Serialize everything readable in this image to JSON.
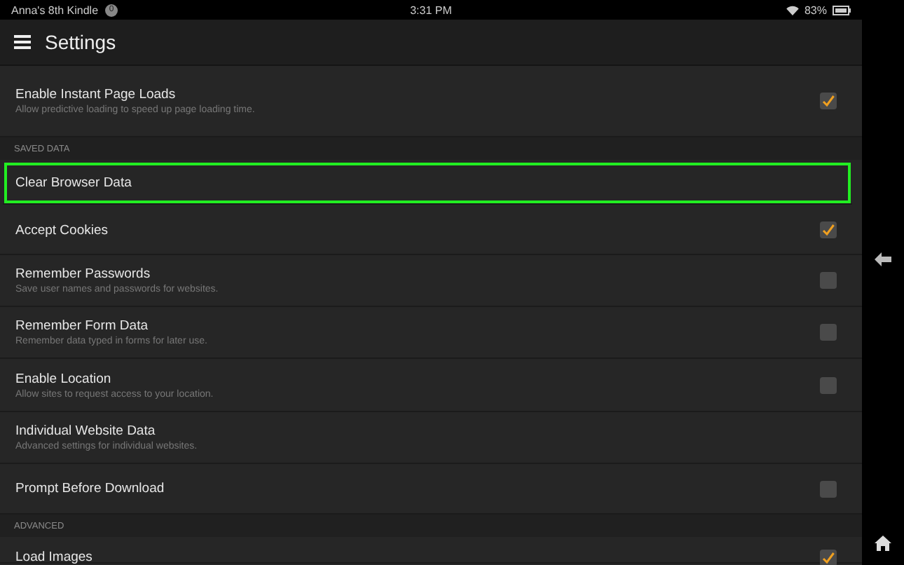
{
  "status_bar": {
    "device_name": "Anna's 8th Kindle",
    "notification_count": "0",
    "time": "3:31 PM",
    "battery": "83%"
  },
  "toolbar": {
    "title": "Settings"
  },
  "items": [
    {
      "kind": "toggle",
      "label": "Enable Instant Page Loads",
      "description": "Allow predictive loading to speed up page loading time.",
      "checked": true,
      "highlighted": false
    },
    {
      "kind": "header",
      "label": "SAVED DATA"
    },
    {
      "kind": "link",
      "label": "Clear Browser Data",
      "highlighted": true
    },
    {
      "kind": "toggle",
      "label": "Accept Cookies",
      "checked": true,
      "highlighted": false
    },
    {
      "kind": "toggle",
      "label": "Remember Passwords",
      "description": "Save user names and passwords for websites.",
      "checked": false,
      "highlighted": false
    },
    {
      "kind": "toggle",
      "label": "Remember Form Data",
      "description": "Remember data typed in forms for later use.",
      "checked": false,
      "highlighted": false
    },
    {
      "kind": "toggle",
      "label": "Enable Location",
      "description": "Allow sites to request access to your location.",
      "checked": false,
      "highlighted": false
    },
    {
      "kind": "link",
      "label": "Individual Website Data",
      "description": "Advanced settings for individual websites.",
      "highlighted": false
    },
    {
      "kind": "toggle",
      "label": "Prompt Before Download",
      "checked": false,
      "highlighted": false
    },
    {
      "kind": "header",
      "label": "ADVANCED"
    },
    {
      "kind": "toggle",
      "label": "Load Images",
      "checked": true,
      "highlighted": false
    }
  ]
}
